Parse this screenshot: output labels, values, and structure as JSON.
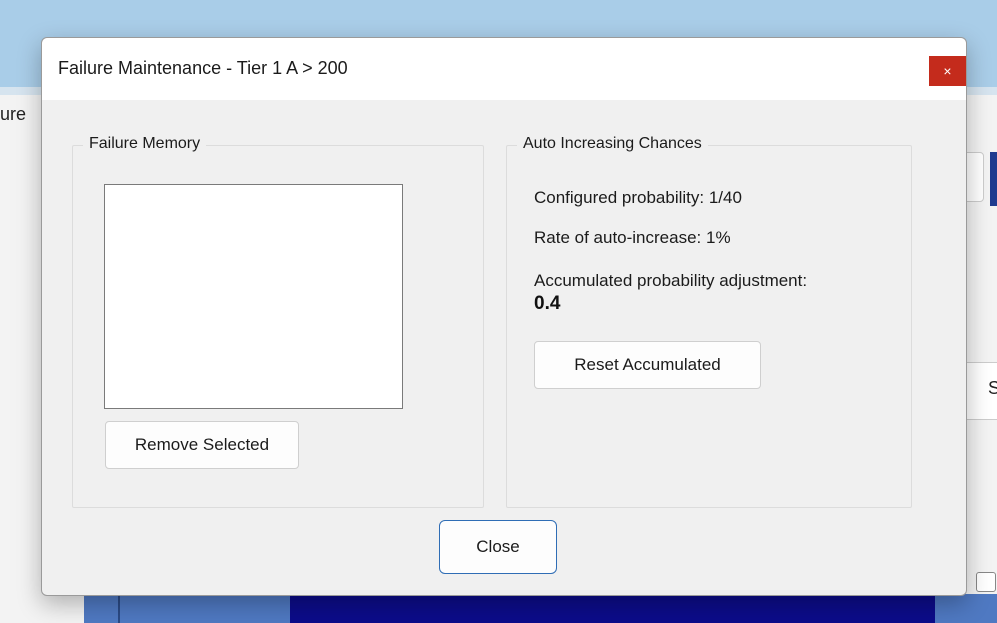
{
  "background_app": {
    "partial_label": "ure",
    "partial_letter": "S"
  },
  "dialog": {
    "title": "Failure Maintenance - Tier 1 A > 200",
    "close_icon": "×",
    "failure_memory": {
      "legend": "Failure Memory",
      "items": [],
      "remove_button_label": "Remove Selected"
    },
    "auto_increasing": {
      "legend": "Auto Increasing Chances",
      "configured_probability": "Configured probability: 1/40",
      "rate_of_auto_increase": "Rate of auto-increase: 1%",
      "accumulated_label": "Accumulated probability adjustment:",
      "accumulated_value": "0.4",
      "reset_button_label": "Reset Accumulated"
    },
    "close_button_label": "Close"
  },
  "colors": {
    "close_accent": "#c42b1c",
    "focus_border": "#2f6db5",
    "titlebar_blue": "#a9cde8",
    "navy": "#0c0c8a"
  }
}
